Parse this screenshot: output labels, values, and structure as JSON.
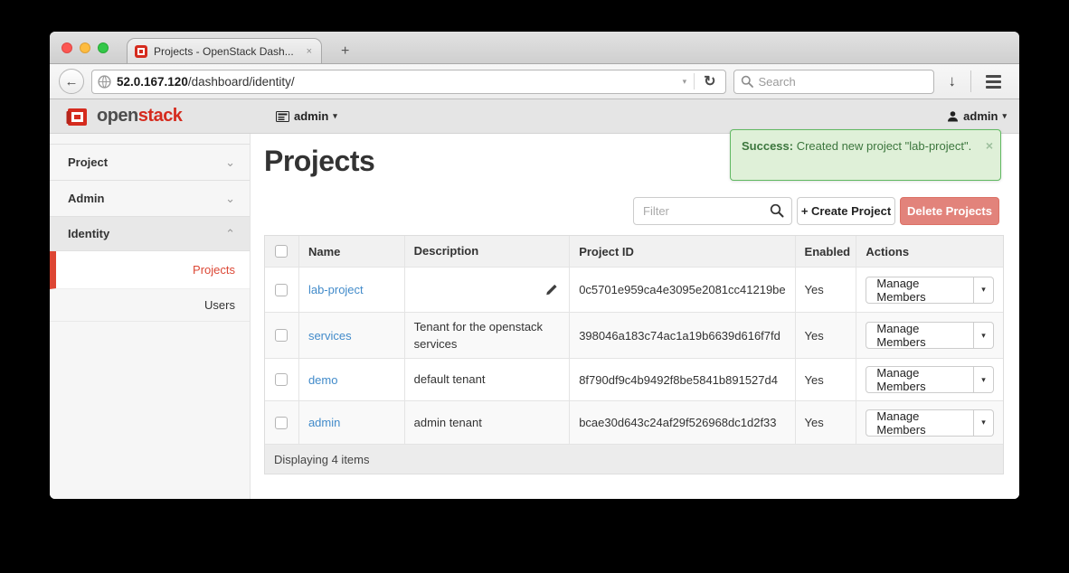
{
  "browser": {
    "tab_title": "Projects - OpenStack Dash...",
    "tab_close": "×",
    "new_tab": "+",
    "back_arrow": "←",
    "url_domain": "52.0.167.120",
    "url_path": "/dashboard/identity/",
    "url_dropdown": "▾",
    "reload": "↻",
    "search_placeholder": "Search",
    "download_arrow": "↓"
  },
  "header": {
    "logo_open": "open",
    "logo_stack": "stack",
    "project_switcher": "admin",
    "user_menu": "admin",
    "caret": "▾"
  },
  "sidebar": {
    "project_label": "Project",
    "admin_label": "Admin",
    "identity_label": "Identity",
    "chevron_down": "⌄",
    "chevron_up": "⌃",
    "projects_label": "Projects",
    "users_label": "Users"
  },
  "page": {
    "title": "Projects"
  },
  "alert": {
    "strong": "Success:",
    "text": " Created new project \"lab-project\".",
    "close": "×"
  },
  "toolbar": {
    "filter_placeholder": "Filter",
    "create_label": "+ Create Project",
    "delete_label": "Delete Projects"
  },
  "table": {
    "headers": [
      "Name",
      "Description",
      "Project ID",
      "Enabled",
      "Actions"
    ],
    "action_label": "Manage Members",
    "action_caret": "▾",
    "rows": [
      {
        "name": "lab-project",
        "description": "",
        "project_id": "0c5701e959ca4e3095e2081cc41219be",
        "enabled": "Yes"
      },
      {
        "name": "services",
        "description": "Tenant for the openstack services",
        "project_id": "398046a183c74ac1a19b6639d616f7fd",
        "enabled": "Yes"
      },
      {
        "name": "demo",
        "description": "default tenant",
        "project_id": "8f790df9c4b9492f8be5841b891527d4",
        "enabled": "Yes"
      },
      {
        "name": "admin",
        "description": "admin tenant",
        "project_id": "bcae30d643c24af29f526968dc1d2f33",
        "enabled": "Yes"
      }
    ],
    "footer": "Displaying 4 items"
  },
  "colors": {
    "accent_red": "#d52b1e",
    "sidebar_active_red": "#dd4533",
    "link_blue": "#428bca",
    "alert_bg": "#dff0d8",
    "alert_border": "#61b962",
    "alert_text": "#3c763d",
    "delete_btn": "#e2837b"
  }
}
